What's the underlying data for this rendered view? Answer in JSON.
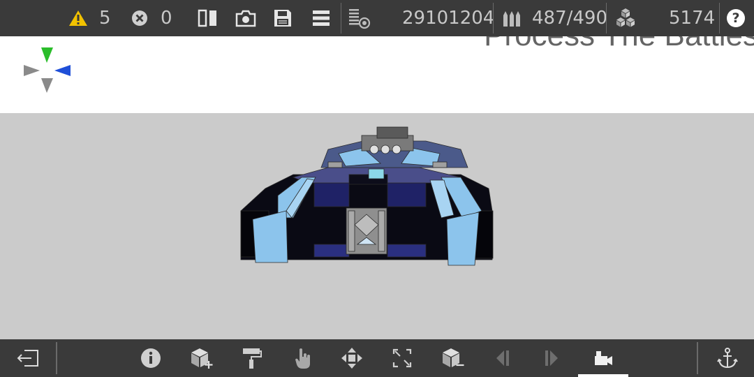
{
  "status": {
    "warnings": "5",
    "errors": "0",
    "cost": "29101204",
    "ammo": "487/490",
    "blocks": "5174",
    "help": "?"
  },
  "watermark": "Process The Battles",
  "colors": {
    "bar_bg": "#3a3a3a",
    "warning": "#f2c200",
    "hull_light": "#8cc4ec",
    "hull_dark": "#1f2266",
    "axis_up": "#2bbd2b",
    "axis_right": "#1f4fd8",
    "axis_neutral": "#8a8a8a"
  },
  "toolbar": {
    "icons": [
      "exit-icon",
      "info-icon",
      "add-block-icon",
      "paint-roller-icon",
      "hand-pointer-icon",
      "move-icon",
      "resize-icon",
      "remove-block-icon",
      "previous-icon",
      "next-icon",
      "camera-mode-icon",
      "anchor-icon"
    ],
    "active": "camera-mode-icon"
  }
}
